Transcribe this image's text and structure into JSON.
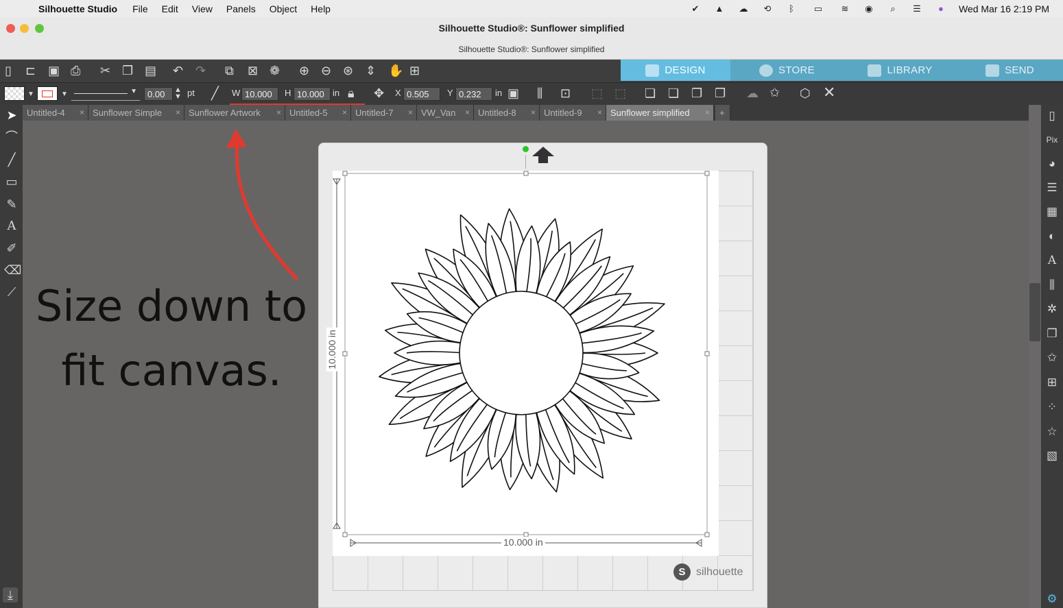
{
  "menubar": {
    "app_name": "Silhouette Studio",
    "menus": [
      "File",
      "Edit",
      "View",
      "Panels",
      "Object",
      "Help"
    ],
    "datetime": "Wed Mar 16  2:19 PM"
  },
  "window": {
    "title": "Silhouette Studio®: Sunflower simplified",
    "subtitle": "Silhouette Studio®: Sunflower simplified"
  },
  "nav_tabs": [
    {
      "label": "DESIGN",
      "active": true
    },
    {
      "label": "STORE",
      "active": false
    },
    {
      "label": "LIBRARY",
      "active": false
    },
    {
      "label": "SEND",
      "active": false
    }
  ],
  "properties": {
    "line_width": "0.00",
    "line_unit": "pt",
    "w_label": "W",
    "w_value": "10.000",
    "h_label": "H",
    "h_value": "10.000",
    "size_unit": "in",
    "x_label": "X",
    "x_value": "0.505",
    "y_label": "Y",
    "y_value": "0.232",
    "pos_unit": "in"
  },
  "doc_tabs": [
    {
      "label": "Untitled-4",
      "active": false
    },
    {
      "label": "Sunflower Simple",
      "active": false
    },
    {
      "label": "Sunflower Artwork",
      "active": false
    },
    {
      "label": "Untitled-5",
      "active": false
    },
    {
      "label": "Untitled-7",
      "active": false
    },
    {
      "label": "VW_Van",
      "active": false
    },
    {
      "label": "Untitled-8",
      "active": false
    },
    {
      "label": "Untitled-9",
      "active": false
    },
    {
      "label": "Sunflower simplified",
      "active": true
    }
  ],
  "canvas": {
    "width_dim": "10.000 in",
    "height_dim": "10.000 in",
    "brand": "silhouette",
    "brand_glyph": "S"
  },
  "annotation": {
    "line1": "Size down to",
    "line2": "fit canvas."
  },
  "colors": {
    "design_tab": "#64bde0",
    "highlight": "#e03a2f",
    "canvas_bg": "#676564"
  }
}
